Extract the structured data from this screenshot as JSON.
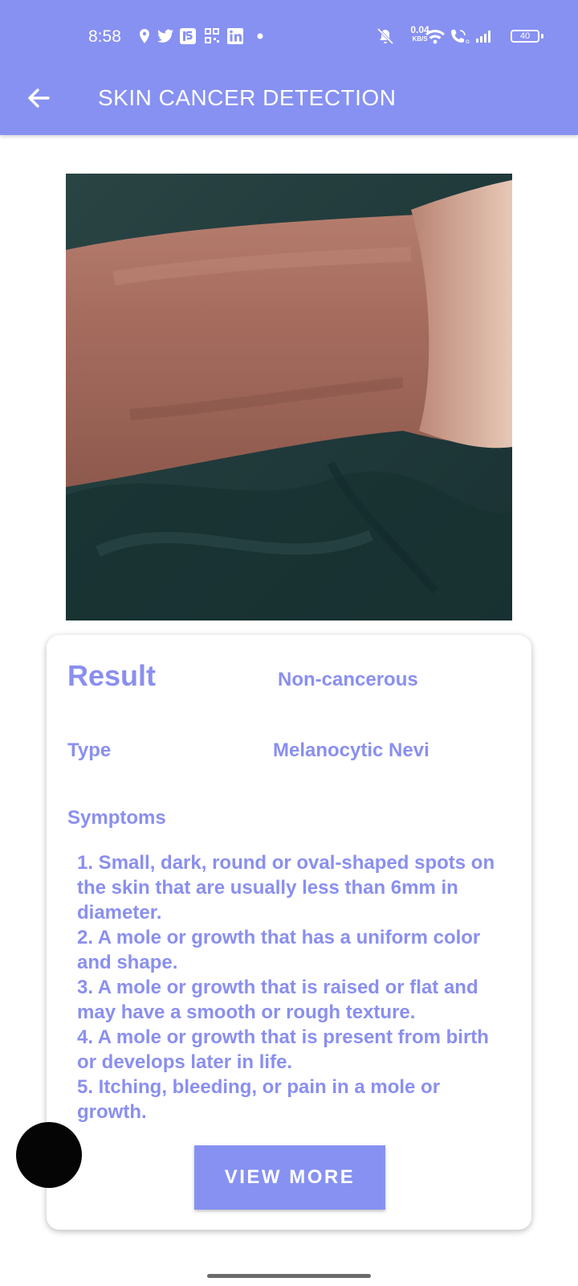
{
  "status_bar": {
    "time": "8:58",
    "net_speed_value": "0.04",
    "net_speed_unit": "KB/S",
    "battery": "40",
    "icons": [
      "location-icon",
      "twitter-icon",
      "is-app-icon",
      "qr-icon",
      "linkedin-icon",
      "dot-icon",
      "muted-bell-icon",
      "wifi-icon",
      "wifi-call-icon",
      "signal-icon",
      "battery-icon"
    ]
  },
  "app_bar": {
    "title": "SKIN CANCER DETECTION",
    "back_icon": "arrow-left-icon",
    "background": "#8791F2"
  },
  "result_card": {
    "result_label": "Result",
    "result_value": "Non-cancerous",
    "type_label": "Type",
    "type_value": "Melanocytic Nevi",
    "symptoms_label": "Symptoms",
    "symptoms": [
      "1. Small, dark, round or oval-shaped spots on the skin that are usually less than 6mm in diameter.",
      "2. A mole or growth that has a uniform color and shape.",
      "3. A mole or growth that is raised or flat and may have a smooth or rough texture.",
      "4. A mole or growth that is present from birth or develops later in life.",
      "5. Itching, bleeding, or pain in a mole or growth."
    ],
    "view_more_label": "VIEW MORE",
    "text_color": "#8A8FEF"
  }
}
